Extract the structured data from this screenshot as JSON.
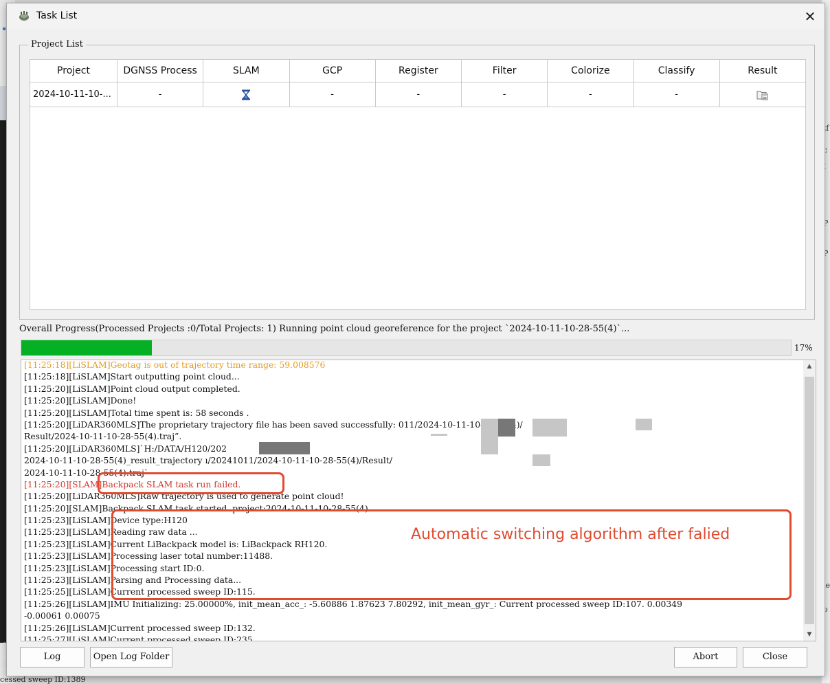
{
  "window": {
    "title": "Task List",
    "close_glyph": "✕"
  },
  "project_list": {
    "legend": "Project List",
    "columns": [
      "Project",
      "DGNSS Process",
      "SLAM",
      "GCP",
      "Register",
      "Filter",
      "Colorize",
      "Classify",
      "Result"
    ],
    "rows": [
      {
        "project": "2024-10-11-10-...",
        "dgnss": "-",
        "slam_icon": "hourglass-icon",
        "gcp": "-",
        "register": "-",
        "filter": "-",
        "colorize": "-",
        "classify": "-",
        "result_icon": "folder-icon"
      }
    ]
  },
  "progress": {
    "label": "Overall Progress(Processed Projects :0/Total Projects: 1) Running point cloud georeference for the project `2024-10-11-10-28-55(4)`...",
    "percent_text": "17%",
    "value": 0.17,
    "color": "#06b025"
  },
  "log": {
    "lines": [
      {
        "text": "[11:25:18][LiSLAM]Geotag is out of trajectory time range: 59.008576",
        "style": "orange"
      },
      {
        "text": "[11:25:18][LiSLAM]Start outputting point cloud...",
        "style": ""
      },
      {
        "text": "[11:25:20][LiSLAM]Point cloud output completed.",
        "style": ""
      },
      {
        "text": "[11:25:20][LiSLAM]Done!",
        "style": ""
      },
      {
        "text": "[11:25:20][LiSLAM]Total time spent is: 58 seconds .",
        "style": ""
      },
      {
        "text": "[11:25:20][LiDAR360MLS]The proprietary trajectory file has been saved successfully:                                                          011/2024-10-11-10-28-55(4)/",
        "style": ""
      },
      {
        "text": "Result/2024-10-11-10-28-55(4).traj”.",
        "style": ""
      },
      {
        "text": "[11:25:20][LiDAR360MLS]`H:/DATA/H120/202",
        "style": ""
      },
      {
        "text": "2024-10-11-10-28-55(4)_result_trajectory                                                                                        ı/20241011/2024-10-11-10-28-55(4)/Result/",
        "style": ""
      },
      {
        "text": "2024-10-11-10-28-55(4).traj`",
        "style": ""
      },
      {
        "text": "[11:25:20][SLAM]Backpack SLAM task run failed.",
        "style": "red"
      },
      {
        "text": "[11:25:20][LiDAR360MLS]Raw trajectory is used to generate point cloud!",
        "style": ""
      },
      {
        "text": "[11:25:20][SLAM]Backpack SLAM task started.    project:2024-10-11-10-28-55(4)",
        "style": ""
      },
      {
        "text": "[11:25:23][LiSLAM]Device type:H120",
        "style": ""
      },
      {
        "text": "[11:25:23][LiSLAM]Reading raw data ...",
        "style": ""
      },
      {
        "text": "[11:25:23][LiSLAM]Current LiBackpack model is: LiBackpack RH120.",
        "style": ""
      },
      {
        "text": "[11:25:23][LiSLAM]Processing laser total number:11488.",
        "style": ""
      },
      {
        "text": "[11:25:23][LiSLAM]Processing start ID:0.",
        "style": ""
      },
      {
        "text": "[11:25:23][LiSLAM]Parsing and Processing data...",
        "style": ""
      },
      {
        "text": "[11:25:25][LiSLAM]Current processed sweep ID:115.",
        "style": ""
      },
      {
        "text": "[11:25:26][LiSLAM]IMU Initializing: 25.00000%, init_mean_acc_: -5.60886  1.87623  7.80292, init_mean_gyr_: Current processed sweep ID:107. 0.00349",
        "style": ""
      },
      {
        "text": "-0.00061  0.00075",
        "style": ""
      },
      {
        "text": "[11:25:26][LiSLAM]Current processed sweep ID:132.",
        "style": ""
      },
      {
        "text": "[11:25:27][LiSLAM]Current processed sweep ID:235.",
        "style": "cut"
      }
    ]
  },
  "annotation": {
    "text": "Automatic switching algorithm after falied",
    "color": "#e04a2f"
  },
  "buttons": {
    "log": "Log",
    "open_log_folder": "Open Log Folder",
    "abort": "Abort",
    "close": "Close"
  },
  "background": {
    "right_chars": [
      "tf",
      "c",
      "I",
      "P",
      "P",
      "le",
      "o"
    ],
    "left_chars": [
      ":e",
      ":e",
      ":e"
    ],
    "bottom_text": "cessed sweep ID:1389"
  }
}
